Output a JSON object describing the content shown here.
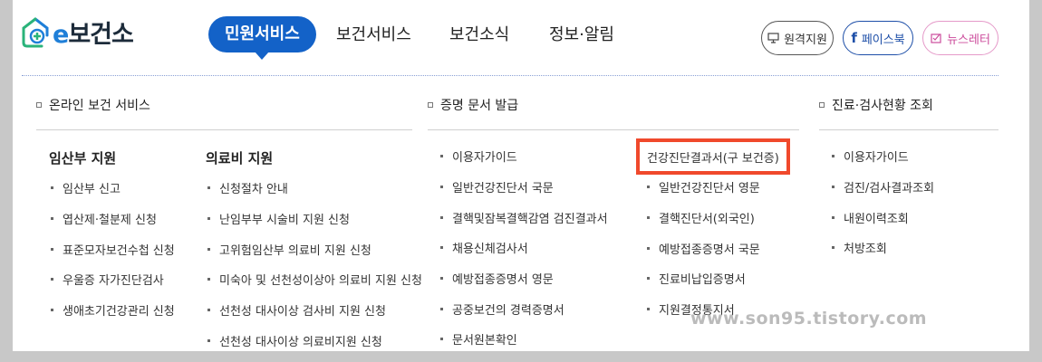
{
  "header": {
    "logo_text": "e보건소",
    "logo_prefix": "e",
    "logo_suffix": "보건소",
    "nav": [
      {
        "label": "민원서비스",
        "active": true
      },
      {
        "label": "보건서비스",
        "active": false
      },
      {
        "label": "보건소식",
        "active": false
      },
      {
        "label": "정보·알림",
        "active": false
      }
    ],
    "buttons": {
      "remote": {
        "label": "원격지원",
        "icon": "monitor-icon"
      },
      "facebook": {
        "label": "페이스북",
        "icon": "facebook-icon"
      },
      "newsletter": {
        "label": "뉴스레터",
        "icon": "newsletter-icon"
      }
    },
    "accent_color": "#1362c8"
  },
  "sections": [
    {
      "title": "온라인 보건 서비스",
      "columns": [
        {
          "title": "임산부 지원",
          "items": [
            "임산부 신고",
            "엽산제·철분제 신청",
            "표준모자보건수첩 신청",
            "우울증 자가진단검사",
            "생애초기건강관리 신청"
          ]
        },
        {
          "title": "의료비 지원",
          "items": [
            "신청절차 안내",
            "난임부부 시술비 지원 신청",
            "고위험임산부 의료비 지원 신청",
            "미숙아 및 선천성이상아 의료비 지원 신청",
            "선천성 대사이상 검사비 지원 신청",
            "선천성 대사이상 의료비지원 신청"
          ]
        }
      ]
    },
    {
      "title": "증명 문서 발급",
      "columns": [
        {
          "items": [
            "이용자가이드",
            "일반건강진단서 국문",
            "결핵및잠복결핵감염 검진결과서",
            "채용신체검사서",
            "예방접종증명서 영문",
            "공중보건의 경력증명서",
            "문서원본확인"
          ]
        },
        {
          "items": [
            "건강진단결과서(구 보건증)",
            "일반건강진단서 영문",
            "결핵진단서(외국인)",
            "예방접종증명서 국문",
            "진료비납입증명서",
            "지원결정통지서"
          ],
          "highlighted_item": "건강진단결과서(구 보건증)",
          "highlight_color": "#f0492c"
        }
      ]
    },
    {
      "title": "진료·검사현황 조회",
      "columns": [
        {
          "items": [
            "이용자가이드",
            "검진/검사결과조회",
            "내원이력조회",
            "처방조회"
          ]
        }
      ]
    }
  ],
  "watermark": "www.son95.tistory.com"
}
